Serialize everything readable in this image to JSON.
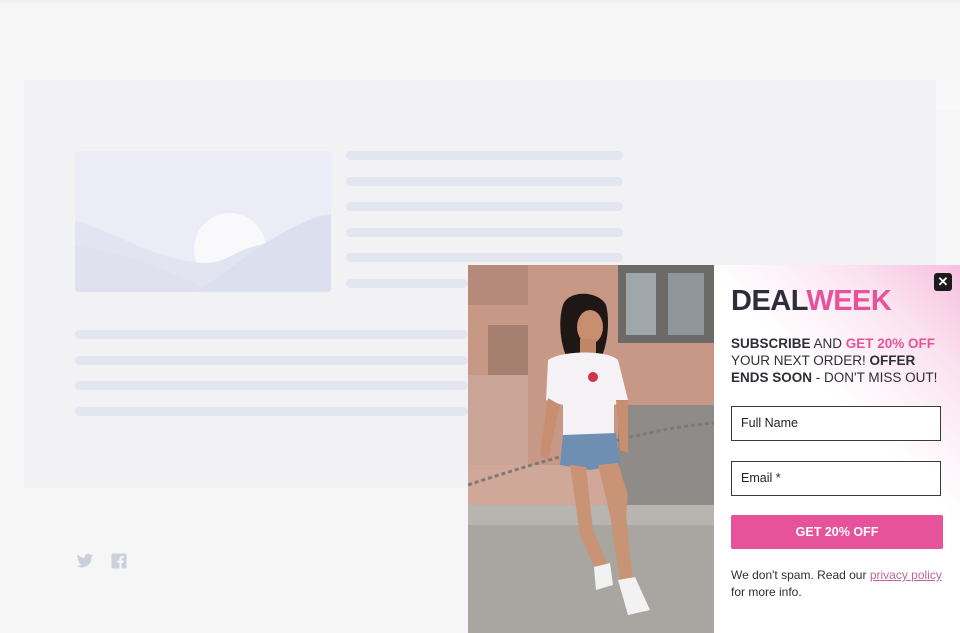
{
  "background_page": {
    "social": {
      "twitter_icon": "twitter-icon",
      "facebook_icon": "facebook-icon"
    }
  },
  "popup": {
    "close_glyph": "✕",
    "logo": {
      "part1": "DEAL",
      "part2": "WEEK"
    },
    "blurb": {
      "p1": "SUBSCRIBE",
      "p2": " AND ",
      "p3": "GET 20% OFF",
      "p4": " YOUR NEXT ORDER! ",
      "p5": "OFFER ENDS SOON",
      "p6": " - DON'T MISS OUT!"
    },
    "fields": {
      "full_name_placeholder": "Full Name",
      "email_placeholder": "Email *"
    },
    "cta_label": "GET 20% OFF",
    "disclaimer": {
      "before": "We don't spam. Read our ",
      "link": "privacy policy",
      "after": " for more info."
    }
  },
  "colors": {
    "accent": "#e6539a",
    "dark": "#2e2e38",
    "placeholder_bar": "#e3e5f1"
  }
}
